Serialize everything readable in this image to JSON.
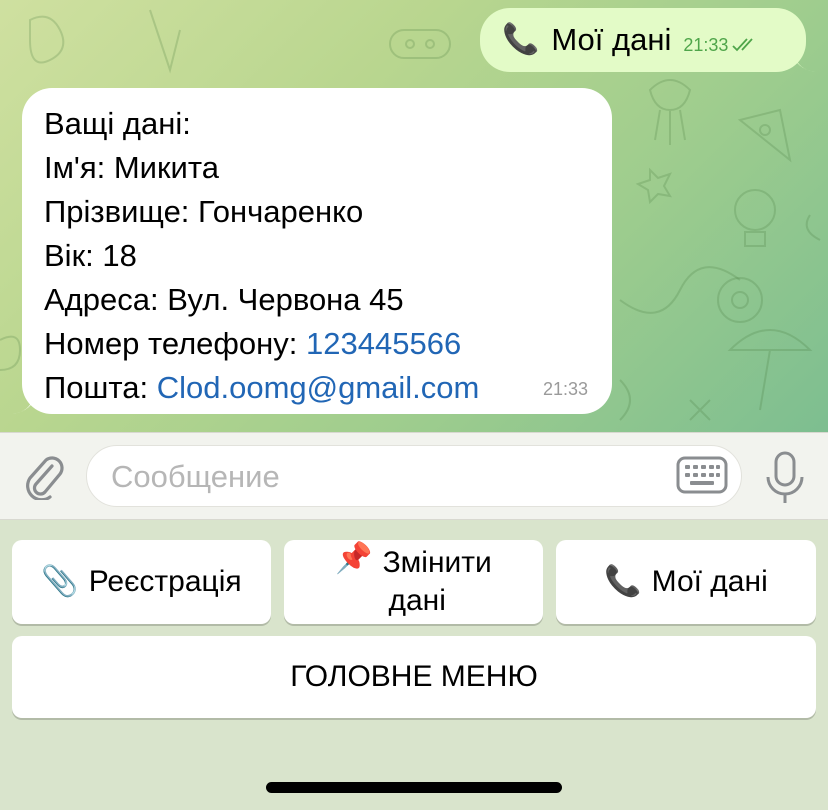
{
  "chat": {
    "outgoing": {
      "text": "Мої дані",
      "time": "21:33"
    },
    "incoming": {
      "lines": [
        "Ващі дані:",
        "Ім'я: Микита",
        "Прізвище: Гончаренко",
        "Вік: 18",
        "Адреса: Вул. Червона 45"
      ],
      "phone_label": "Номер телефону: ",
      "phone_value": "123445566",
      "email_label": "Пошта: ",
      "email_value": "Clod.oomg@gmail.com",
      "time": "21:33"
    }
  },
  "composer": {
    "placeholder": "Сообщение"
  },
  "reply_keyboard": {
    "buttons": [
      {
        "label": "Реєстрація",
        "icon": "paperclip-emoji"
      },
      {
        "label_line1": "Змінити",
        "label_line2": "дані",
        "icon": "pushpin-emoji"
      },
      {
        "label": "Мої дані",
        "icon": "telephone-emoji"
      }
    ],
    "main_menu": "ГОЛОВНЕ МЕНЮ"
  },
  "colors": {
    "outgoing_bubble": "#e3fbc7",
    "incoming_bubble": "#ffffff",
    "link": "#2166b5",
    "read_check": "#4fa54a"
  }
}
